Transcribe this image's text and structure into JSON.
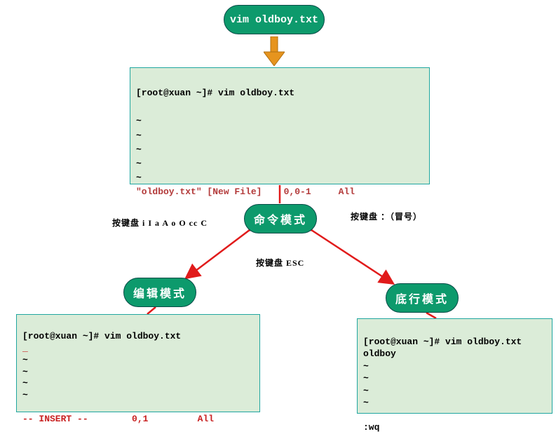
{
  "top_pill": "vim oldboy.txt",
  "cmd_pill": "命令模式",
  "edit_pill": "编辑模式",
  "last_pill": "底行模式",
  "label_keys_edit": "按键盘 i I a A o O cc C",
  "label_keys_colon": "按键盘 ：（冒号）",
  "label_keys_esc": "按键盘 ESC",
  "panel_top": {
    "l1": "[root@xuan ~]# vim oldboy.txt",
    "tilde": "~",
    "status": "\"oldboy.txt\" [New File]    0,0-1     All"
  },
  "panel_bl": {
    "l1": "[root@xuan ~]# vim oldboy.txt",
    "dash": "_",
    "tilde": "~",
    "status": "-- INSERT --        0,1         All"
  },
  "panel_br": {
    "l1": "[root@xuan ~]# vim oldboy.txt",
    "l2": "oldboy",
    "tilde": "~",
    "wq": ":wq"
  }
}
